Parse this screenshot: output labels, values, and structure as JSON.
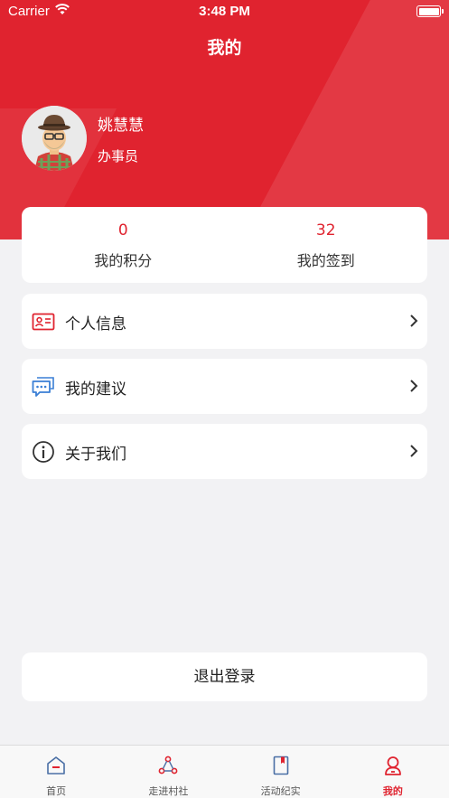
{
  "status_bar": {
    "carrier": "Carrier",
    "time": "3:48 PM"
  },
  "nav": {
    "title": "我的"
  },
  "profile": {
    "name": "姚慧慧",
    "role": "办事员"
  },
  "stats": [
    {
      "value": "0",
      "label": "我的积分"
    },
    {
      "value": "32",
      "label": "我的签到"
    }
  ],
  "menu": [
    {
      "label": "个人信息",
      "icon": "id-card-icon"
    },
    {
      "label": "我的建议",
      "icon": "chat-bubble-icon"
    },
    {
      "label": "关于我们",
      "icon": "info-circle-icon"
    }
  ],
  "logout_label": "退出登录",
  "tabs": [
    {
      "label": "首页",
      "icon": "home-icon",
      "active": false
    },
    {
      "label": "走进村社",
      "icon": "community-icon",
      "active": false
    },
    {
      "label": "活动纪实",
      "icon": "bookmark-book-icon",
      "active": false
    },
    {
      "label": "我的",
      "icon": "user-icon",
      "active": true
    }
  ],
  "colors": {
    "accent": "#e0232f",
    "background": "#f2f2f4",
    "icon_blue": "#3a7fd5"
  }
}
